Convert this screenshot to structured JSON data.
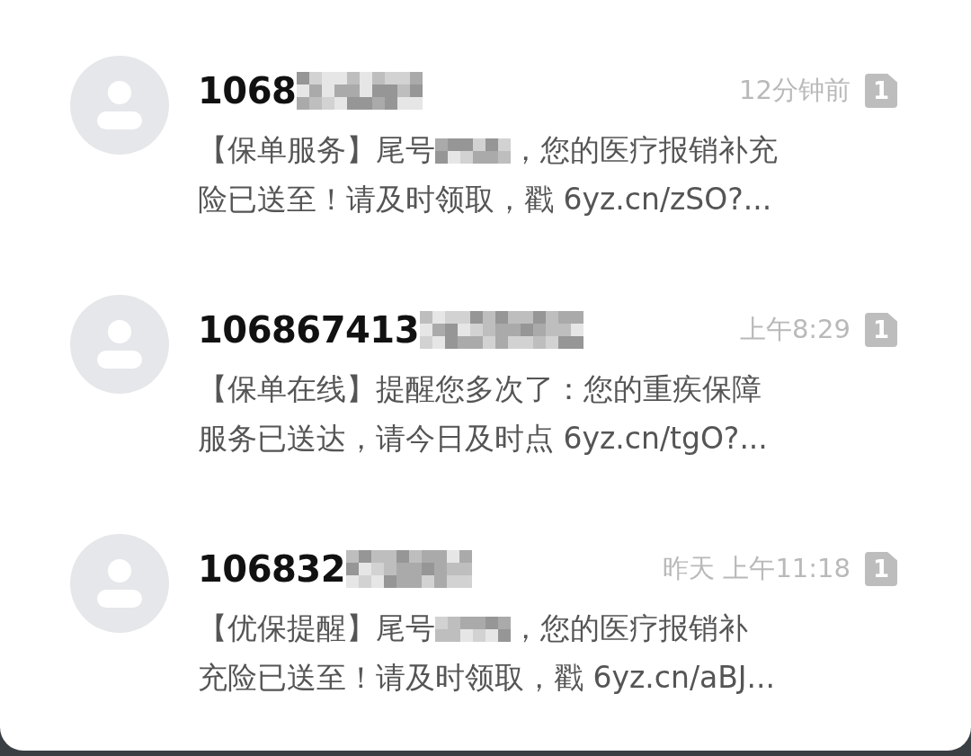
{
  "messages": [
    {
      "sender": "1068",
      "time": "12分钟前",
      "sim": "1",
      "line1_start": "【保单服务】尾号",
      "line1_end": "，您的医疗报销补充",
      "line2": "险已送至！请及时领取，戳 6yz.cn/zSO?..."
    },
    {
      "sender": "106867413",
      "time": "上午8:29",
      "sim": "1",
      "line1_start": "【保单在线】提醒您多次了：您的重疾保障",
      "line2": "服务已送达，请今日及时点 6yz.cn/tgO?..."
    },
    {
      "sender": "106832",
      "time": "昨天 上午11:18",
      "sim": "1",
      "line1_start": "【优保提醒】尾号",
      "line1_end": "，您的医疗报销补",
      "line2": "充险已送至！请及时领取，戳 6yz.cn/aBJ..."
    }
  ]
}
